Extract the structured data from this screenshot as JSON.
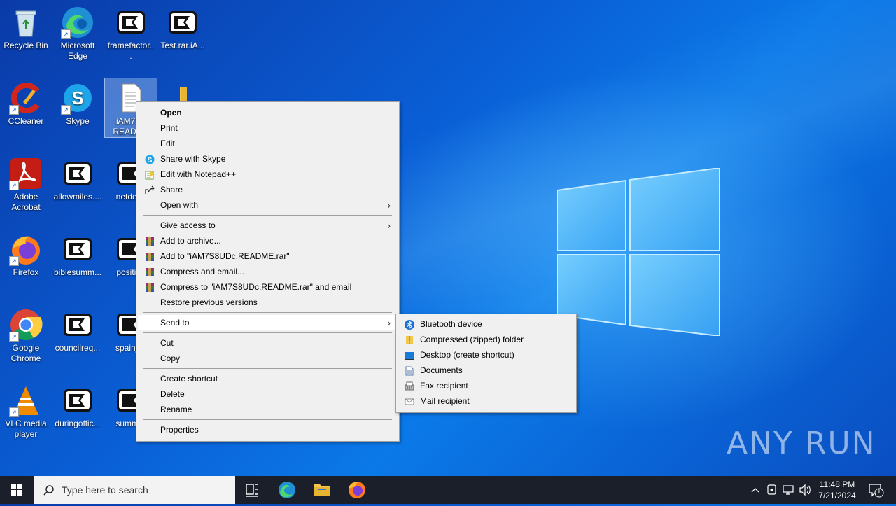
{
  "desktop_icons": [
    {
      "label": "Recycle Bin"
    },
    {
      "label": "Microsoft Edge"
    },
    {
      "label": "framefactor..."
    },
    {
      "label": "Test.rar.iA..."
    },
    {
      "label": "CCleaner"
    },
    {
      "label": "Skype"
    },
    {
      "label": "iAM7S8 README"
    },
    {
      "label": ""
    },
    {
      "label": "Adobe Acrobat"
    },
    {
      "label": "allowmiles...."
    },
    {
      "label": "netdeve"
    },
    {
      "label": "Firefox"
    },
    {
      "label": "biblesumm..."
    },
    {
      "label": "position"
    },
    {
      "label": "Google Chrome"
    },
    {
      "label": "councilreq..."
    },
    {
      "label": "spainjac"
    },
    {
      "label": "VLC media player"
    },
    {
      "label": "duringoffic..."
    },
    {
      "label": "summar"
    }
  ],
  "context_menu": {
    "items": [
      {
        "label": "Open"
      },
      {
        "label": "Print"
      },
      {
        "label": "Edit"
      },
      {
        "label": "Share with Skype"
      },
      {
        "label": "Edit with Notepad++"
      },
      {
        "label": "Share"
      },
      {
        "label": "Open with"
      },
      {
        "label": "Give access to"
      },
      {
        "label": "Add to archive..."
      },
      {
        "label": "Add to \"iAM7S8UDc.README.rar\""
      },
      {
        "label": "Compress and email..."
      },
      {
        "label": "Compress to \"iAM7S8UDc.README.rar\" and email"
      },
      {
        "label": "Restore previous versions"
      },
      {
        "label": "Send to"
      },
      {
        "label": "Cut"
      },
      {
        "label": "Copy"
      },
      {
        "label": "Create shortcut"
      },
      {
        "label": "Delete"
      },
      {
        "label": "Rename"
      },
      {
        "label": "Properties"
      }
    ]
  },
  "send_to_menu": {
    "items": [
      {
        "label": "Bluetooth device"
      },
      {
        "label": "Compressed (zipped) folder"
      },
      {
        "label": "Desktop (create shortcut)"
      },
      {
        "label": "Documents"
      },
      {
        "label": "Fax recipient"
      },
      {
        "label": "Mail recipient"
      }
    ]
  },
  "taskbar": {
    "search_placeholder": "Type here to search",
    "clock_time": "11:48 PM",
    "clock_date": "7/21/2024",
    "notification_count": "1"
  },
  "watermark": "ANY RUN"
}
